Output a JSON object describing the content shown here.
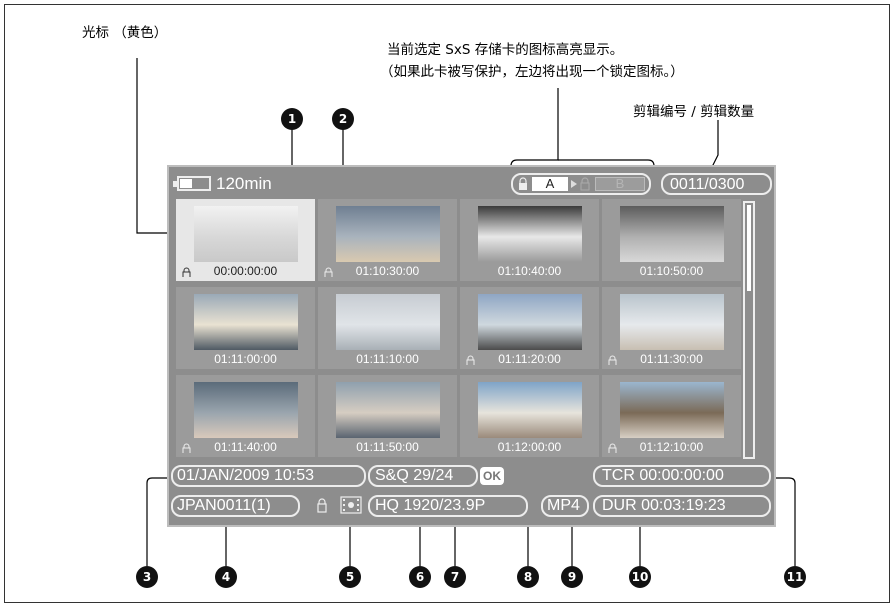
{
  "annotations": {
    "cursor_label": "光标 （黄色）",
    "media_line1": "当前选定 SxS 存储卡的图标高亮显示。",
    "media_line2": "（如果此卡被写保护，左边将出现一个锁定图标。）",
    "clip_number_label": "剪辑编号 / 剪辑数量"
  },
  "callouts": [
    "1",
    "2",
    "3",
    "4",
    "5",
    "6",
    "7",
    "8",
    "9",
    "10",
    "11"
  ],
  "screen": {
    "battery_text": "120min",
    "slot_a": "A",
    "slot_b": "B",
    "clip_counter": "0011/0300",
    "thumbnails": [
      {
        "timecode": "00:00:00:00",
        "locked": true,
        "selected": true
      },
      {
        "timecode": "01:10:30:00",
        "locked": true,
        "selected": false
      },
      {
        "timecode": "01:10:40:00",
        "locked": false,
        "selected": false
      },
      {
        "timecode": "01:10:50:00",
        "locked": false,
        "selected": false
      },
      {
        "timecode": "01:11:00:00",
        "locked": false,
        "selected": false
      },
      {
        "timecode": "01:11:10:00",
        "locked": false,
        "selected": false
      },
      {
        "timecode": "01:11:20:00",
        "locked": true,
        "selected": false
      },
      {
        "timecode": "01:11:30:00",
        "locked": true,
        "selected": false
      },
      {
        "timecode": "01:11:40:00",
        "locked": true,
        "selected": false
      },
      {
        "timecode": "01:11:50:00",
        "locked": false,
        "selected": false
      },
      {
        "timecode": "01:12:00:00",
        "locked": false,
        "selected": false
      },
      {
        "timecode": "01:12:10:00",
        "locked": true,
        "selected": false
      }
    ],
    "date_time": "01/JAN/2009 10:53",
    "sq_rate": "S&Q 29/24",
    "ok_mark": "OK",
    "timecode_tcr": "TCR 00:00:00:00",
    "clip_name": "JPAN0011(1)",
    "video_format": "HQ 1920/23.9P",
    "file_format": "MP4",
    "duration": "DUR 00:03:19:23"
  }
}
